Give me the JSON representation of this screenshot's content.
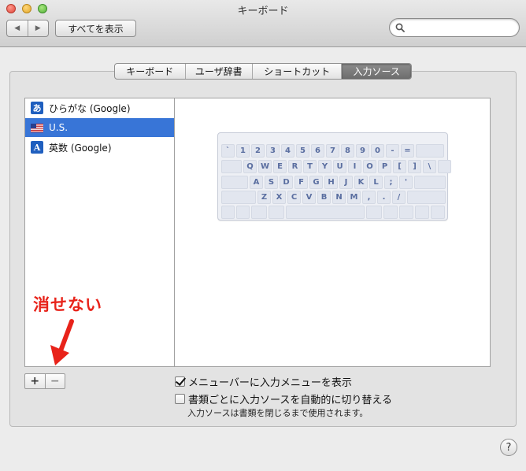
{
  "window": {
    "title": "キーボード",
    "show_all_label": "すべてを表示",
    "nav_back": "◀",
    "nav_forward": "▶",
    "search": {
      "value": "",
      "placeholder": ""
    }
  },
  "tabs": [
    {
      "label": "キーボード",
      "active": false
    },
    {
      "label": "ユーザ辞書",
      "active": false
    },
    {
      "label": "ショートカット",
      "active": false
    },
    {
      "label": "入力ソース",
      "active": true
    }
  ],
  "input_sources": [
    {
      "label": "ひらがな (Google)",
      "icon": "hiragana-a-icon",
      "glyph": "あ",
      "selected": false
    },
    {
      "label": "U.S.",
      "icon": "us-flag-icon",
      "glyph": "",
      "selected": true
    },
    {
      "label": "英数 (Google)",
      "icon": "eisu-a-icon",
      "glyph": "A",
      "selected": false
    }
  ],
  "keyboard": {
    "rows": [
      [
        "`",
        "1",
        "2",
        "3",
        "4",
        "5",
        "6",
        "7",
        "8",
        "9",
        "0",
        "-",
        "="
      ],
      [
        "Q",
        "W",
        "E",
        "R",
        "T",
        "Y",
        "U",
        "I",
        "O",
        "P",
        "[",
        "]",
        "\\"
      ],
      [
        "A",
        "S",
        "D",
        "F",
        "G",
        "H",
        "J",
        "K",
        "L",
        ";",
        "'"
      ],
      [
        "Z",
        "X",
        "C",
        "V",
        "B",
        "N",
        "M",
        ",",
        ".",
        "/"
      ]
    ]
  },
  "annotation": {
    "text": "消せない",
    "color": "#e8231a"
  },
  "buttons": {
    "add": "+",
    "remove": "−"
  },
  "options": [
    {
      "label": "メニューバーに入力メニューを表示",
      "checked": true
    },
    {
      "label": "書類ごとに入力ソースを自動的に切り替える",
      "checked": false
    }
  ],
  "note": "入力ソースは書類を閉じるまで使用されます。",
  "help_label": "?",
  "colors": {
    "selection": "#3875d7",
    "annotation": "#e8231a"
  }
}
